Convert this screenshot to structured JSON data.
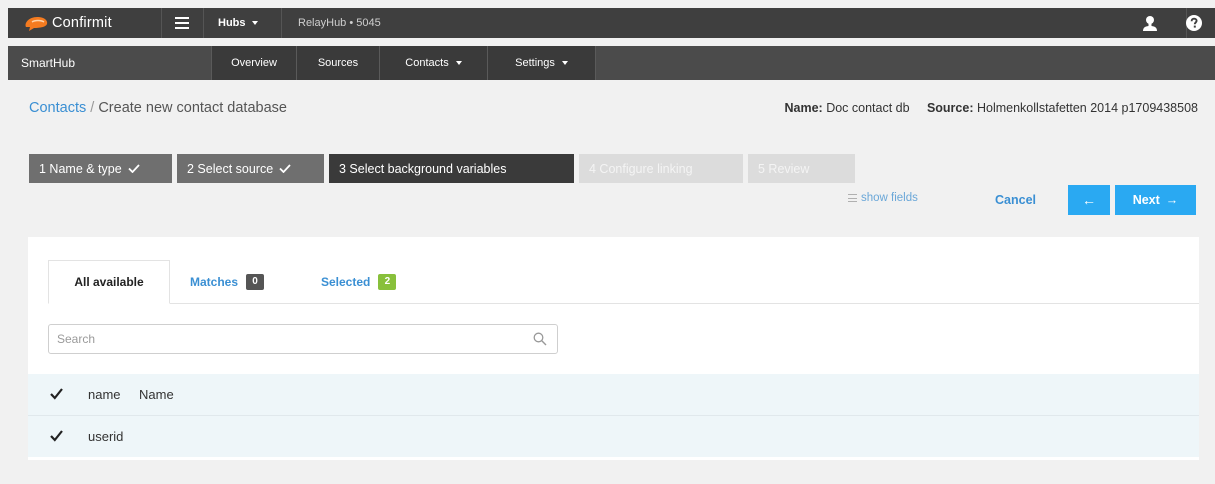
{
  "topbar": {
    "brand": "Confirmit",
    "hubs_label": "Hubs",
    "relayhub": "RelayHub • 5045",
    "brand_color": "#f47b20"
  },
  "subnav": {
    "title": "SmartHub",
    "items": [
      "Overview",
      "Sources",
      "Contacts",
      "Settings"
    ]
  },
  "breadcrumb": {
    "link": "Contacts",
    "separator": " / ",
    "current": "Create new contact database"
  },
  "meta": {
    "name_label": "Name:",
    "name_value": "Doc contact db",
    "source_label": "Source:",
    "source_value": "Holmenkollstafetten 2014 p1709438508"
  },
  "steps": [
    {
      "label": "1 Name & type",
      "state": "done"
    },
    {
      "label": "2 Select source",
      "state": "done"
    },
    {
      "label": "3 Select background variables",
      "state": "current"
    },
    {
      "label": "4 Configure linking",
      "state": "future"
    },
    {
      "label": "5 Review",
      "state": "future"
    }
  ],
  "actions": {
    "show_fields": "show fields",
    "cancel": "Cancel",
    "back_arrow": "←",
    "next": "Next",
    "next_arrow": "→",
    "accent": "#2aa9f2"
  },
  "tabs": {
    "all": "All available",
    "matches": "Matches",
    "matches_count": "0",
    "selected": "Selected",
    "selected_count": "2"
  },
  "search": {
    "placeholder": "Search"
  },
  "rows": [
    {
      "name": "name",
      "description": "Name",
      "checked": true
    },
    {
      "name": "userid",
      "description": "",
      "checked": true
    }
  ]
}
